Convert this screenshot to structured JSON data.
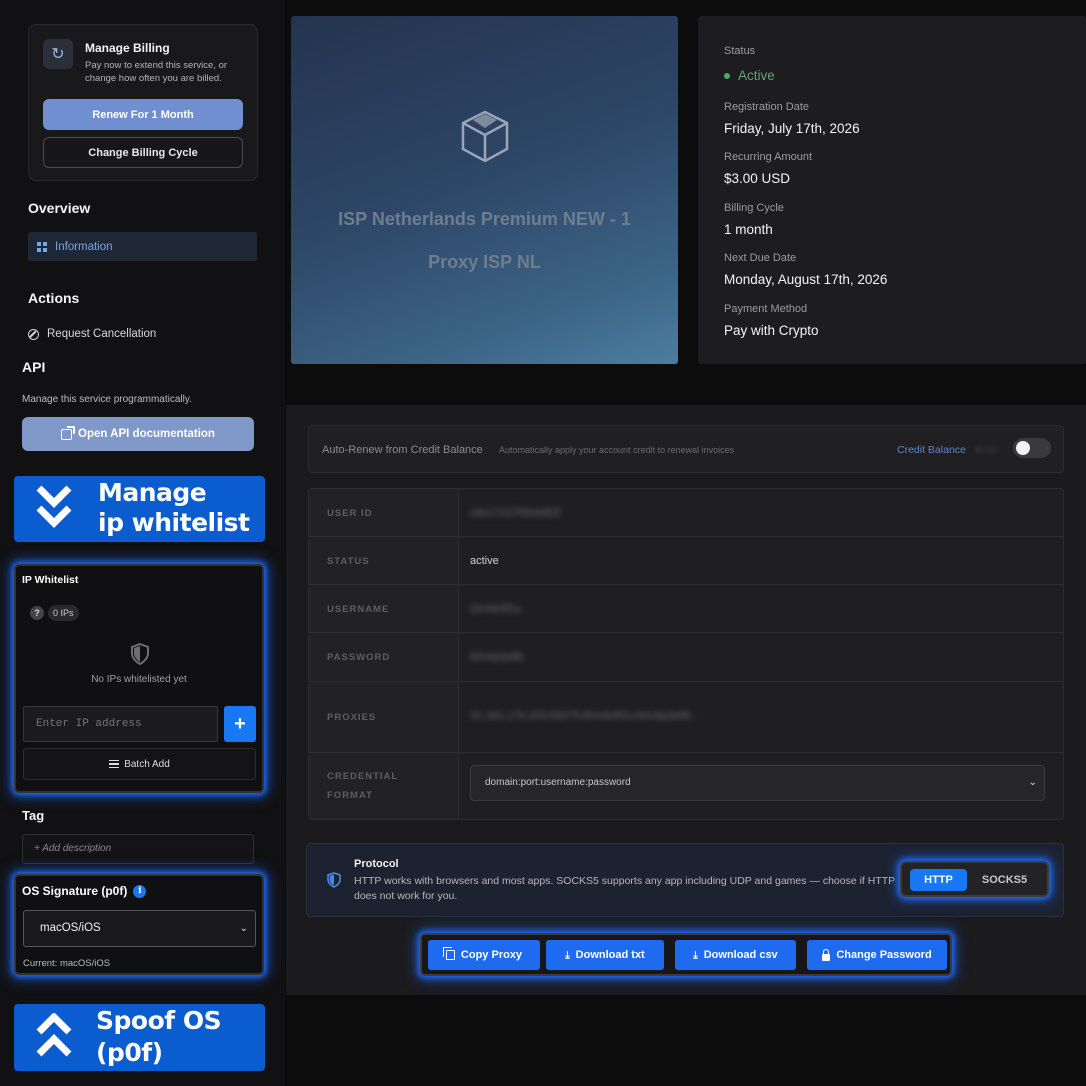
{
  "billing": {
    "title": "Manage Billing",
    "description": "Pay now to extend this service, or change how often you are billed.",
    "renew_label": "Renew For 1 Month",
    "cycle_label": "Change Billing Cycle"
  },
  "sidebar": {
    "overview_heading": "Overview",
    "overview_item": "Information",
    "actions_heading": "Actions",
    "cancel_label": "Request Cancellation",
    "api_heading": "API",
    "api_description": "Manage this service programmatically.",
    "api_button": "Open API documentation"
  },
  "promos": {
    "manage_line1": "Manage",
    "manage_line2": "ip whitelist",
    "spoof_line1": "Spoof OS",
    "spoof_line2": "(p0f)"
  },
  "ip_whitelist": {
    "title": "IP Whitelist",
    "help_glyph": "?",
    "count": "0 IPs",
    "empty_text": "No IPs whitelisted yet",
    "input_placeholder": "Enter IP address",
    "add_glyph": "+",
    "batch_label": "Batch Add"
  },
  "tag": {
    "title": "Tag",
    "placeholder": "+ Add description"
  },
  "os_signature": {
    "title": "OS Signature (p0f)",
    "info_glyph": "i",
    "selected": "macOS/iOS",
    "current": "Current: macOS/iOS"
  },
  "hero": {
    "title_line1": "ISP Netherlands Premium NEW - 1",
    "title_line2": "Proxy ISP NL"
  },
  "details": {
    "status_label": "Status",
    "status_value": "Active",
    "registration_label": "Registration Date",
    "registration_value": "Friday, July 17th, 2026",
    "recurring_label": "Recurring Amount",
    "recurring_value": "$3.00 USD",
    "cycle_label": "Billing Cycle",
    "cycle_value": "1 month",
    "next_due_label": "Next Due Date",
    "next_due_value": "Monday, August 17th, 2026",
    "payment_label": "Payment Method",
    "payment_value": "Pay with Crypto"
  },
  "auto_renew": {
    "label": "Auto-Renew from Credit Balance",
    "description": "Automatically apply your account credit to renewal invoices",
    "credit_label": "Credit Balance",
    "credit_value": "$0.00",
    "enabled": false
  },
  "credentials": {
    "user_id_label": "USER ID",
    "user_id_value": "cbe17c07f0b4d82f",
    "status_label": "STATUS",
    "status_value": "active",
    "username_label": "USERNAME",
    "username_value": "i2m4e9f1u",
    "password_label": "PASSWORD",
    "password_value": "k0v4p2e8b",
    "proxies_label": "PROXIES",
    "proxies_value": "31.181.176.203:59275:i5m4e9f1u:k0v4p2e8b",
    "format_label_1": "CREDENTIAL",
    "format_label_2": "FORMAT",
    "format_value": "domain:port:username:password"
  },
  "protocol": {
    "title": "Protocol",
    "description": "HTTP works with browsers and most apps. SOCKS5 supports any app including UDP and games — choose if HTTP does not work for you.",
    "http_label": "HTTP",
    "socks_label": "SOCKS5",
    "selected": "HTTP"
  },
  "actions": {
    "copy": "Copy Proxy",
    "download_txt": "Download txt",
    "download_csv": "Download csv",
    "change_password": "Change Password"
  },
  "colors": {
    "accent": "#1877f2",
    "promo": "#0b5ccf",
    "status_active": "#4faa63",
    "link": "#5d85c8"
  }
}
